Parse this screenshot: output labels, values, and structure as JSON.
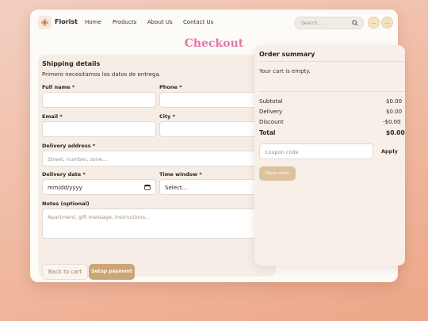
{
  "nav": {
    "brand": "Florist",
    "links": [
      "Home",
      "Products",
      "About Us",
      "Contact Us"
    ],
    "search_placeholder": "Search...",
    "buttons": [
      "...",
      "..."
    ]
  },
  "page": {
    "title": "Checkout"
  },
  "shipping": {
    "title": "Shipping details",
    "subtitle": "Primero necesitamos los datos de entrega.",
    "full_name_label": "Full name *",
    "phone_label": "Phone *",
    "email_label": "Email *",
    "city_label": "City *",
    "address_label": "Delivery address *",
    "address_placeholder": "Street, number, zone...",
    "date_label": "Delivery date *",
    "date_value": "mm/dd/yyyy",
    "window_label": "Time window *",
    "window_value": "Select...",
    "notes_label": "Notes (optional)",
    "notes_placeholder": "Apartment, gift message, instructions...",
    "back_label": "Back to cart",
    "setup_label": "Setup payment"
  },
  "summary": {
    "title": "Order summary",
    "empty_text": "Your cart is empty.",
    "rows": [
      {
        "label": "Subtotal",
        "value": "$0.00"
      },
      {
        "label": "Delivery",
        "value": "$0.00"
      },
      {
        "label": "Discount",
        "value": "-$0.00"
      },
      {
        "label": "Total",
        "value": "$0.00"
      }
    ],
    "coupon_placeholder": "Coupon code",
    "apply_label": "Apply",
    "place_order_label": "Place order"
  },
  "colors": {
    "accent_pink": "#e276a8",
    "gold": "#caa674",
    "panel": "#f6eee6"
  },
  "icons": [
    "flower-logo-icon",
    "search-icon",
    "calendar-icon",
    "chevron-down-icon"
  ]
}
